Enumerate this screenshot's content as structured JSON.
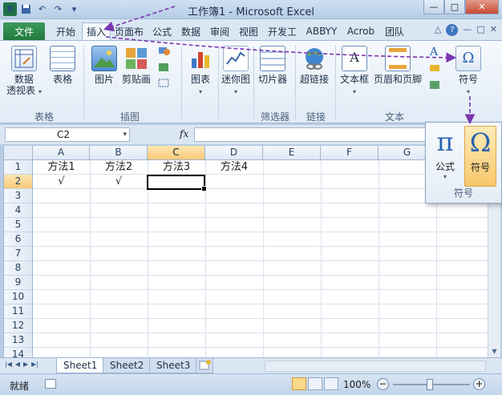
{
  "window": {
    "title": "工作簿1 - Microsoft Excel",
    "qat_icons": [
      "excel-app-icon",
      "save-icon",
      "undo-icon",
      "redo-icon",
      "customize-qat-icon"
    ],
    "buttons": [
      "—",
      "□",
      "✕"
    ]
  },
  "tabs": {
    "file": "文件",
    "items": [
      "开始",
      "插入",
      "页面布",
      "公式",
      "数据",
      "审阅",
      "视图",
      "开发工",
      "ABBYY",
      "Acrob",
      "团队"
    ],
    "active": "插入",
    "right_controls": [
      "△",
      "?",
      "—",
      "□",
      "✕"
    ]
  },
  "ribbon": {
    "groups": [
      {
        "label": "表格",
        "buttons": [
          {
            "label": "数据\n透视表",
            "caret": "▾",
            "icon": "pivot-table-icon"
          },
          {
            "label": "表格",
            "icon": "table-icon"
          }
        ]
      },
      {
        "label": "插图",
        "buttons": [
          {
            "label": "图片",
            "icon": "picture-icon"
          },
          {
            "label": "剪贴画",
            "icon": "clipart-icon"
          }
        ]
      },
      {
        "label": "",
        "buttons": [
          {
            "label": "图表",
            "caret": "▾",
            "icon": "chart-icon"
          }
        ]
      },
      {
        "label": "",
        "buttons": [
          {
            "label": "迷你图",
            "caret": "▾",
            "icon": "sparkline-icon"
          }
        ]
      },
      {
        "label": "筛选器",
        "buttons": [
          {
            "label": "切片器",
            "icon": "slicer-icon"
          }
        ]
      },
      {
        "label": "链接",
        "buttons": [
          {
            "label": "超链接",
            "icon": "hyperlink-icon"
          }
        ]
      },
      {
        "label": "文本",
        "buttons": [
          {
            "label": "文本框",
            "caret": "▾",
            "icon": "textbox-icon"
          },
          {
            "label": "页眉和页脚",
            "icon": "header-footer-icon"
          }
        ]
      },
      {
        "label": "",
        "buttons": [
          {
            "label": "符号",
            "caret": "▾",
            "icon": "omega-icon"
          }
        ]
      }
    ]
  },
  "formula_bar": {
    "name_box": "C2",
    "fx": "fx",
    "formula": ""
  },
  "grid": {
    "columns": [
      "A",
      "B",
      "C",
      "D",
      "E",
      "F",
      "G"
    ],
    "selected_column": "C",
    "rows": [
      "1",
      "2",
      "3",
      "4",
      "5",
      "6",
      "7",
      "8",
      "9",
      "10",
      "11",
      "12",
      "13",
      "14"
    ],
    "selected_row": "2",
    "cells": {
      "A1": "方法1",
      "B1": "方法2",
      "C1": "方法3",
      "D1": "方法4",
      "A2": "√",
      "B2": "√",
      "C2": ""
    },
    "active_cell": "C2"
  },
  "sheets": {
    "tabs": [
      "Sheet1",
      "Sheet2",
      "Sheet3"
    ],
    "active": "Sheet1",
    "nav_arrows": [
      "|◀",
      "◀",
      "▶",
      "▶|"
    ]
  },
  "status": {
    "ready": "就绪",
    "zoom": "100%",
    "zoom_minus": "−",
    "zoom_plus": "+"
  },
  "symbol_popup": {
    "equation": {
      "symbol": "π",
      "label": "公式",
      "caret": "▾"
    },
    "symbol": {
      "symbol": "Ω",
      "label": "符号"
    },
    "group_label": "符号"
  },
  "colors": {
    "accent": "#217a3f",
    "annotation": "#7a35b0",
    "highlight": "#f8c86b"
  }
}
